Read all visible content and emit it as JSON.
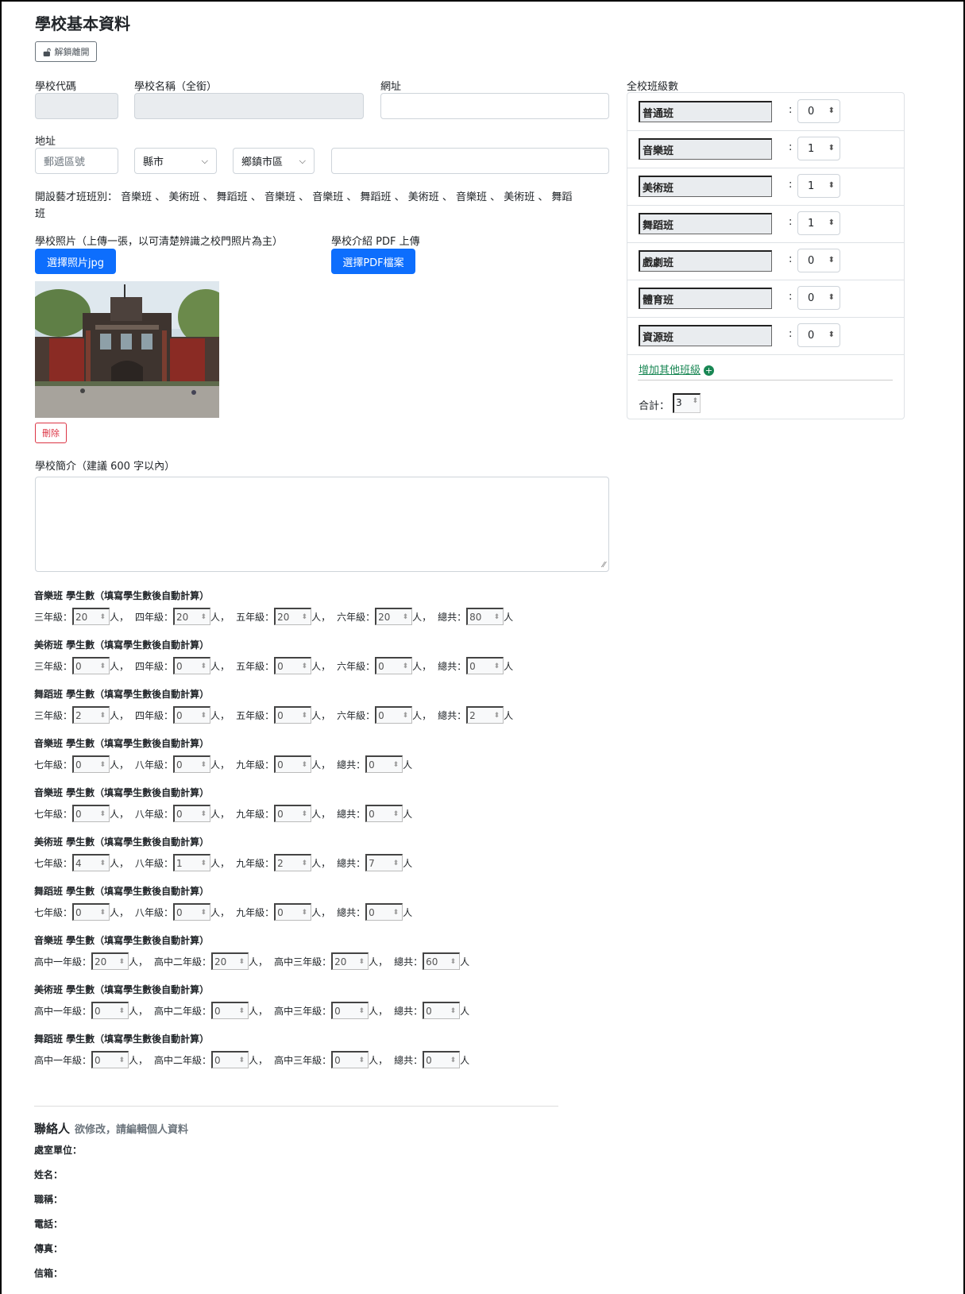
{
  "page_title": "學校基本資料",
  "unlock_button": "解鎖離開",
  "labels": {
    "school_code": "學校代碼",
    "school_name": "學校名稱（全銜）",
    "website": "網址",
    "address": "地址",
    "art_classes_prefix": "開設藝才班班別：",
    "art_classes_list": "音樂班 、 美術班 、 舞蹈班 、 音樂班 、 音樂班 、 舞蹈班 、 美術班 、 音樂班 、 美術班 、 舞蹈",
    "art_classes_wrap": "班",
    "photo": "學校照片（上傳一張，以可清楚辨識之校門照片為主）",
    "pdf": "學校介紹 PDF 上傳",
    "intro": "學校簡介（建議 600 字以內）"
  },
  "inputs": {
    "postal_placeholder": "郵遞區號",
    "county_select": "縣市",
    "township_select": "鄉鎮市區"
  },
  "buttons": {
    "choose_photo": "選擇照片jpg",
    "choose_pdf": "選擇PDF檔案",
    "delete": "刪除"
  },
  "class_panel": {
    "title": "全校班級數",
    "rows": [
      {
        "name": "普通班",
        "count": "0"
      },
      {
        "name": "音樂班",
        "count": "1"
      },
      {
        "name": "美術班",
        "count": "1"
      },
      {
        "name": "舞蹈班",
        "count": "1"
      },
      {
        "name": "戲劇班",
        "count": "0"
      },
      {
        "name": "體育班",
        "count": "0"
      },
      {
        "name": "資源班",
        "count": "0"
      }
    ],
    "add_link": "增加其他班級",
    "total_label": "合計：",
    "total_value": "3"
  },
  "student_sections": [
    {
      "title": "音樂班 學生數（填寫學生數後自動計算）",
      "grades": [
        "三年級：",
        "四年級：",
        "五年級：",
        "六年級："
      ],
      "values": [
        "20",
        "20",
        "20",
        "20"
      ],
      "total": "80"
    },
    {
      "title": "美術班 學生數（填寫學生數後自動計算）",
      "grades": [
        "三年級：",
        "四年級：",
        "五年級：",
        "六年級："
      ],
      "values": [
        "0",
        "0",
        "0",
        "0"
      ],
      "total": "0"
    },
    {
      "title": "舞蹈班 學生數（填寫學生數後自動計算）",
      "grades": [
        "三年級：",
        "四年級：",
        "五年級：",
        "六年級："
      ],
      "values": [
        "2",
        "0",
        "0",
        "0"
      ],
      "total": "2"
    },
    {
      "title": "音樂班 學生數（填寫學生數後自動計算）",
      "grades": [
        "七年級：",
        "八年級：",
        "九年級："
      ],
      "values": [
        "0",
        "0",
        "0"
      ],
      "total": "0"
    },
    {
      "title": "音樂班 學生數（填寫學生數後自動計算）",
      "grades": [
        "七年級：",
        "八年級：",
        "九年級："
      ],
      "values": [
        "0",
        "0",
        "0"
      ],
      "total": "0"
    },
    {
      "title": "美術班 學生數（填寫學生數後自動計算）",
      "grades": [
        "七年級：",
        "八年級：",
        "九年級："
      ],
      "values": [
        "4",
        "1",
        "2"
      ],
      "total": "7"
    },
    {
      "title": "舞蹈班 學生數（填寫學生數後自動計算）",
      "grades": [
        "七年級：",
        "八年級：",
        "九年級："
      ],
      "values": [
        "0",
        "0",
        "0"
      ],
      "total": "0"
    },
    {
      "title": "音樂班 學生數（填寫學生數後自動計算）",
      "grades": [
        "高中一年級：",
        "高中二年級：",
        "高中三年級："
      ],
      "values": [
        "20",
        "20",
        "20"
      ],
      "total": "60"
    },
    {
      "title": "美術班 學生數（填寫學生數後自動計算）",
      "grades": [
        "高中一年級：",
        "高中二年級：",
        "高中三年級："
      ],
      "values": [
        "0",
        "0",
        "0"
      ],
      "total": "0"
    },
    {
      "title": "舞蹈班 學生數（填寫學生數後自動計算）",
      "grades": [
        "高中一年級：",
        "高中二年級：",
        "高中三年級："
      ],
      "values": [
        "0",
        "0",
        "0"
      ],
      "total": "0"
    }
  ],
  "student_units": {
    "person_sep": "人，",
    "person_end": "人",
    "total_label": "總共："
  },
  "contact": {
    "title": "聯絡人",
    "hint": "欲修改，請編輯個人資料",
    "fields": [
      "處室單位：",
      "姓名：",
      "職稱：",
      "電話：",
      "傳真：",
      "信箱："
    ]
  }
}
